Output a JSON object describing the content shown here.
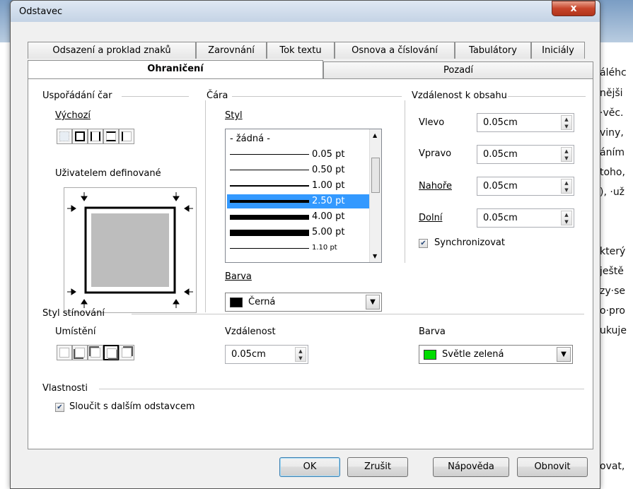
{
  "window_title": "Odstavec",
  "close_glyph": "x",
  "background_text": [
    "áléhc",
    "nějši",
    "·věc.",
    "viny,",
    "áním",
    "toho,",
    "), ·už",
    "který",
    "ještě",
    "zy·se",
    "o·pro",
    "ukuje",
    "ovat,"
  ],
  "tabs_row1": [
    "Odsazení a proklad znaků",
    "Zarovnání",
    "Tok textu",
    "Osnova a číslování",
    "Tabulátory",
    "Iniciály"
  ],
  "tabs_row2": [
    "Ohraničení",
    "Pozadí"
  ],
  "line_arrangement": {
    "title": "Uspořádání čar",
    "default_label": "Výchozí",
    "user_defined_label": "Uživatelem definované"
  },
  "line": {
    "title": "Čára",
    "style_label": "Styl",
    "styles": [
      "- žádná -",
      "0.05 pt",
      "0.50 pt",
      "1.00 pt",
      "2.50 pt",
      "4.00 pt",
      "5.00 pt",
      "1.10 pt"
    ],
    "selected_style": "2.50 pt",
    "color_label": "Barva",
    "color_value": "Černá",
    "color_hex": "#000000"
  },
  "spacing": {
    "title": "Vzdálenost k obsahu",
    "left_label": "Vlevo",
    "left_value": "0.05cm",
    "right_label": "Vpravo",
    "right_value": "0.05cm",
    "top_label": "Nahoře",
    "top_value": "0.05cm",
    "bottom_label": "Dolní",
    "bottom_value": "0.05cm",
    "sync_label": "Synchronizovat",
    "sync_checked": true
  },
  "shadow": {
    "title": "Styl stínování",
    "position_label": "Umístění",
    "distance_label": "Vzdálenost",
    "distance_value": "0.05cm",
    "color_label": "Barva",
    "color_value": "Světle zelená",
    "color_hex": "#00dd00"
  },
  "properties": {
    "title": "Vlastnosti",
    "merge_label": "Sloučit s dalším odstavcem",
    "merge_checked": true
  },
  "buttons": {
    "ok": "OK",
    "cancel": "Zrušit",
    "help": "Nápověda",
    "reset": "Obnovit"
  }
}
